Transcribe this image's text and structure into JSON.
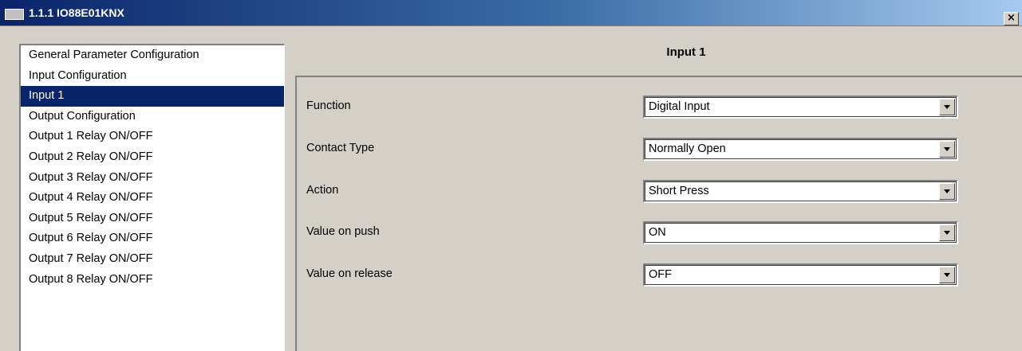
{
  "window": {
    "title": "1.1.1 IO88E01KNX",
    "close_label": "×"
  },
  "nav": {
    "items": [
      {
        "label": "General Parameter Configuration"
      },
      {
        "label": "Input Configuration"
      },
      {
        "label": "Input 1",
        "selected": true
      },
      {
        "label": "Output Configuration"
      },
      {
        "label": "Output 1 Relay ON/OFF"
      },
      {
        "label": "Output 2 Relay ON/OFF"
      },
      {
        "label": "Output 3 Relay ON/OFF"
      },
      {
        "label": "Output 4 Relay ON/OFF"
      },
      {
        "label": "Output 5 Relay ON/OFF"
      },
      {
        "label": "Output 6 Relay ON/OFF"
      },
      {
        "label": "Output 7 Relay ON/OFF"
      },
      {
        "label": "Output 8 Relay ON/OFF"
      }
    ]
  },
  "panel": {
    "title": "Input 1",
    "params": [
      {
        "label": "Function",
        "value": "Digital Input"
      },
      {
        "label": "Contact Type",
        "value": "Normally Open"
      },
      {
        "label": "Action",
        "value": "Short Press"
      },
      {
        "label": "Value on push",
        "value": "ON"
      },
      {
        "label": "Value on release",
        "value": "OFF"
      }
    ]
  },
  "colors": {
    "selection": "#0a246a",
    "dialog_face": "#d4d0c8"
  }
}
